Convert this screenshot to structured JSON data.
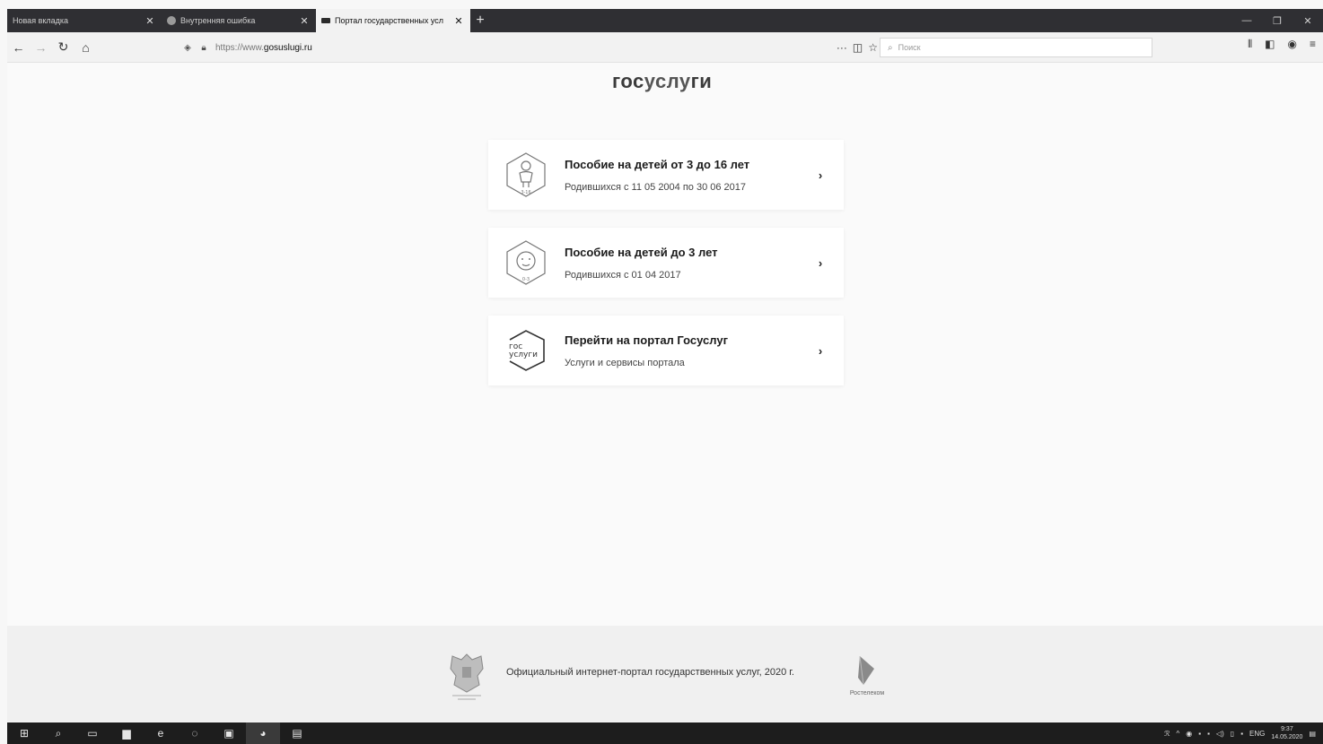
{
  "browser": {
    "tabs": [
      {
        "title": "Новая вкладка",
        "active": false
      },
      {
        "title": "Внутренняя ошибка",
        "active": false
      },
      {
        "title": "Портал государственных усл",
        "active": true
      }
    ],
    "new_tab": "+",
    "url_prefix": "https://www.",
    "url_domain": "gosuslugi.ru",
    "search_placeholder": "Поиск"
  },
  "page": {
    "logo": {
      "part1": "гос",
      "part2": "услу",
      "part3": "ги"
    },
    "cards": [
      {
        "title": "Пособие на детей от 3 до 16 лет",
        "subtitle": "Родившихся с 11 05 2004 по 30 06 2017",
        "icon": "child-3-16-icon",
        "icon_label": "3-16"
      },
      {
        "title": "Пособие на детей до 3 лет",
        "subtitle": "Родившихся с 01 04 2017",
        "icon": "baby-0-3-icon",
        "icon_label": "0-3"
      },
      {
        "title": "Перейти на портал Госуслуг",
        "subtitle": "Услуги и сервисы портала",
        "icon": "gosuslugi-logo-icon",
        "icon_label_top": "гос",
        "icon_label_bottom": "услуги"
      }
    ],
    "footer": {
      "text": "Официальный интернет-портал государственных услуг, 2020 г.",
      "rostelecom_label": "Ростелеком"
    }
  },
  "taskbar": {
    "lang": "ENG",
    "time": "9:37",
    "date": "14.05.2020"
  }
}
